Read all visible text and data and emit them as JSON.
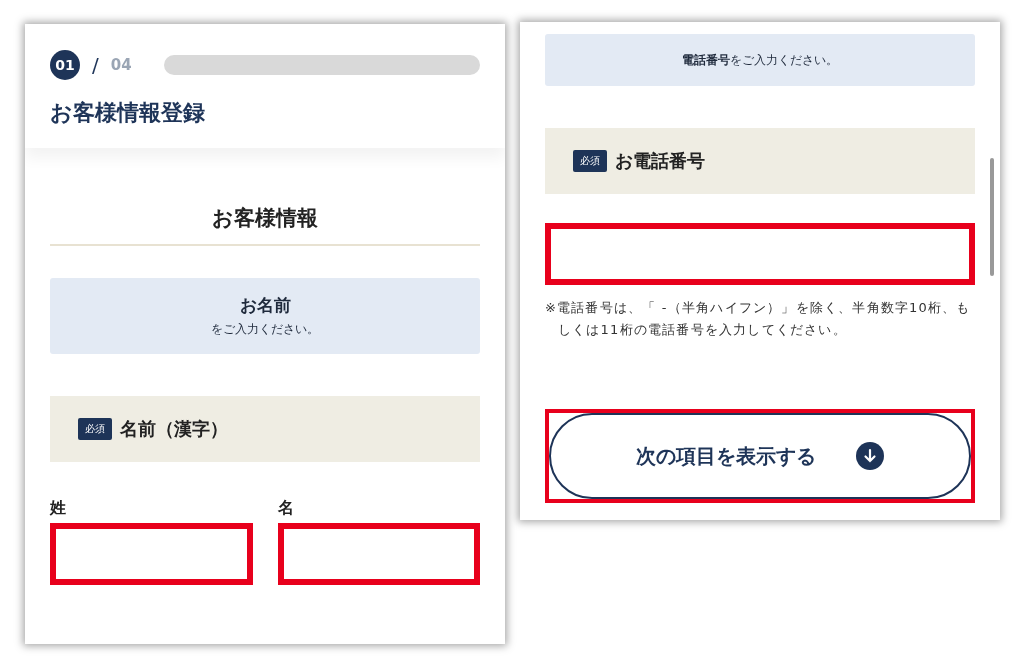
{
  "left_screen": {
    "step": {
      "current": "01",
      "separator": "/",
      "total": "04"
    },
    "page_title": "お客様情報登録",
    "section_title": "お客様情報",
    "prompt": {
      "heading": "お名前",
      "text": "をご入力ください。"
    },
    "field_label": {
      "badge": "必須",
      "label": "名前（漢字）"
    },
    "inputs": [
      {
        "label": "姓",
        "highlighted": true
      },
      {
        "label": "名",
        "highlighted": true
      }
    ]
  },
  "right_screen": {
    "prompt": "**電話番号**をご入力ください。",
    "field_label": {
      "badge": "必須",
      "label": "お電話番号"
    },
    "phone_input": {
      "highlighted": true
    },
    "note": "※電話番号は、「 -（半角ハイフン）」を除く、半角数字10桁、もしくは11桁の電話番号を入力してください。",
    "next_button": {
      "label": "次の項目を表示する",
      "highlighted": true
    }
  }
}
